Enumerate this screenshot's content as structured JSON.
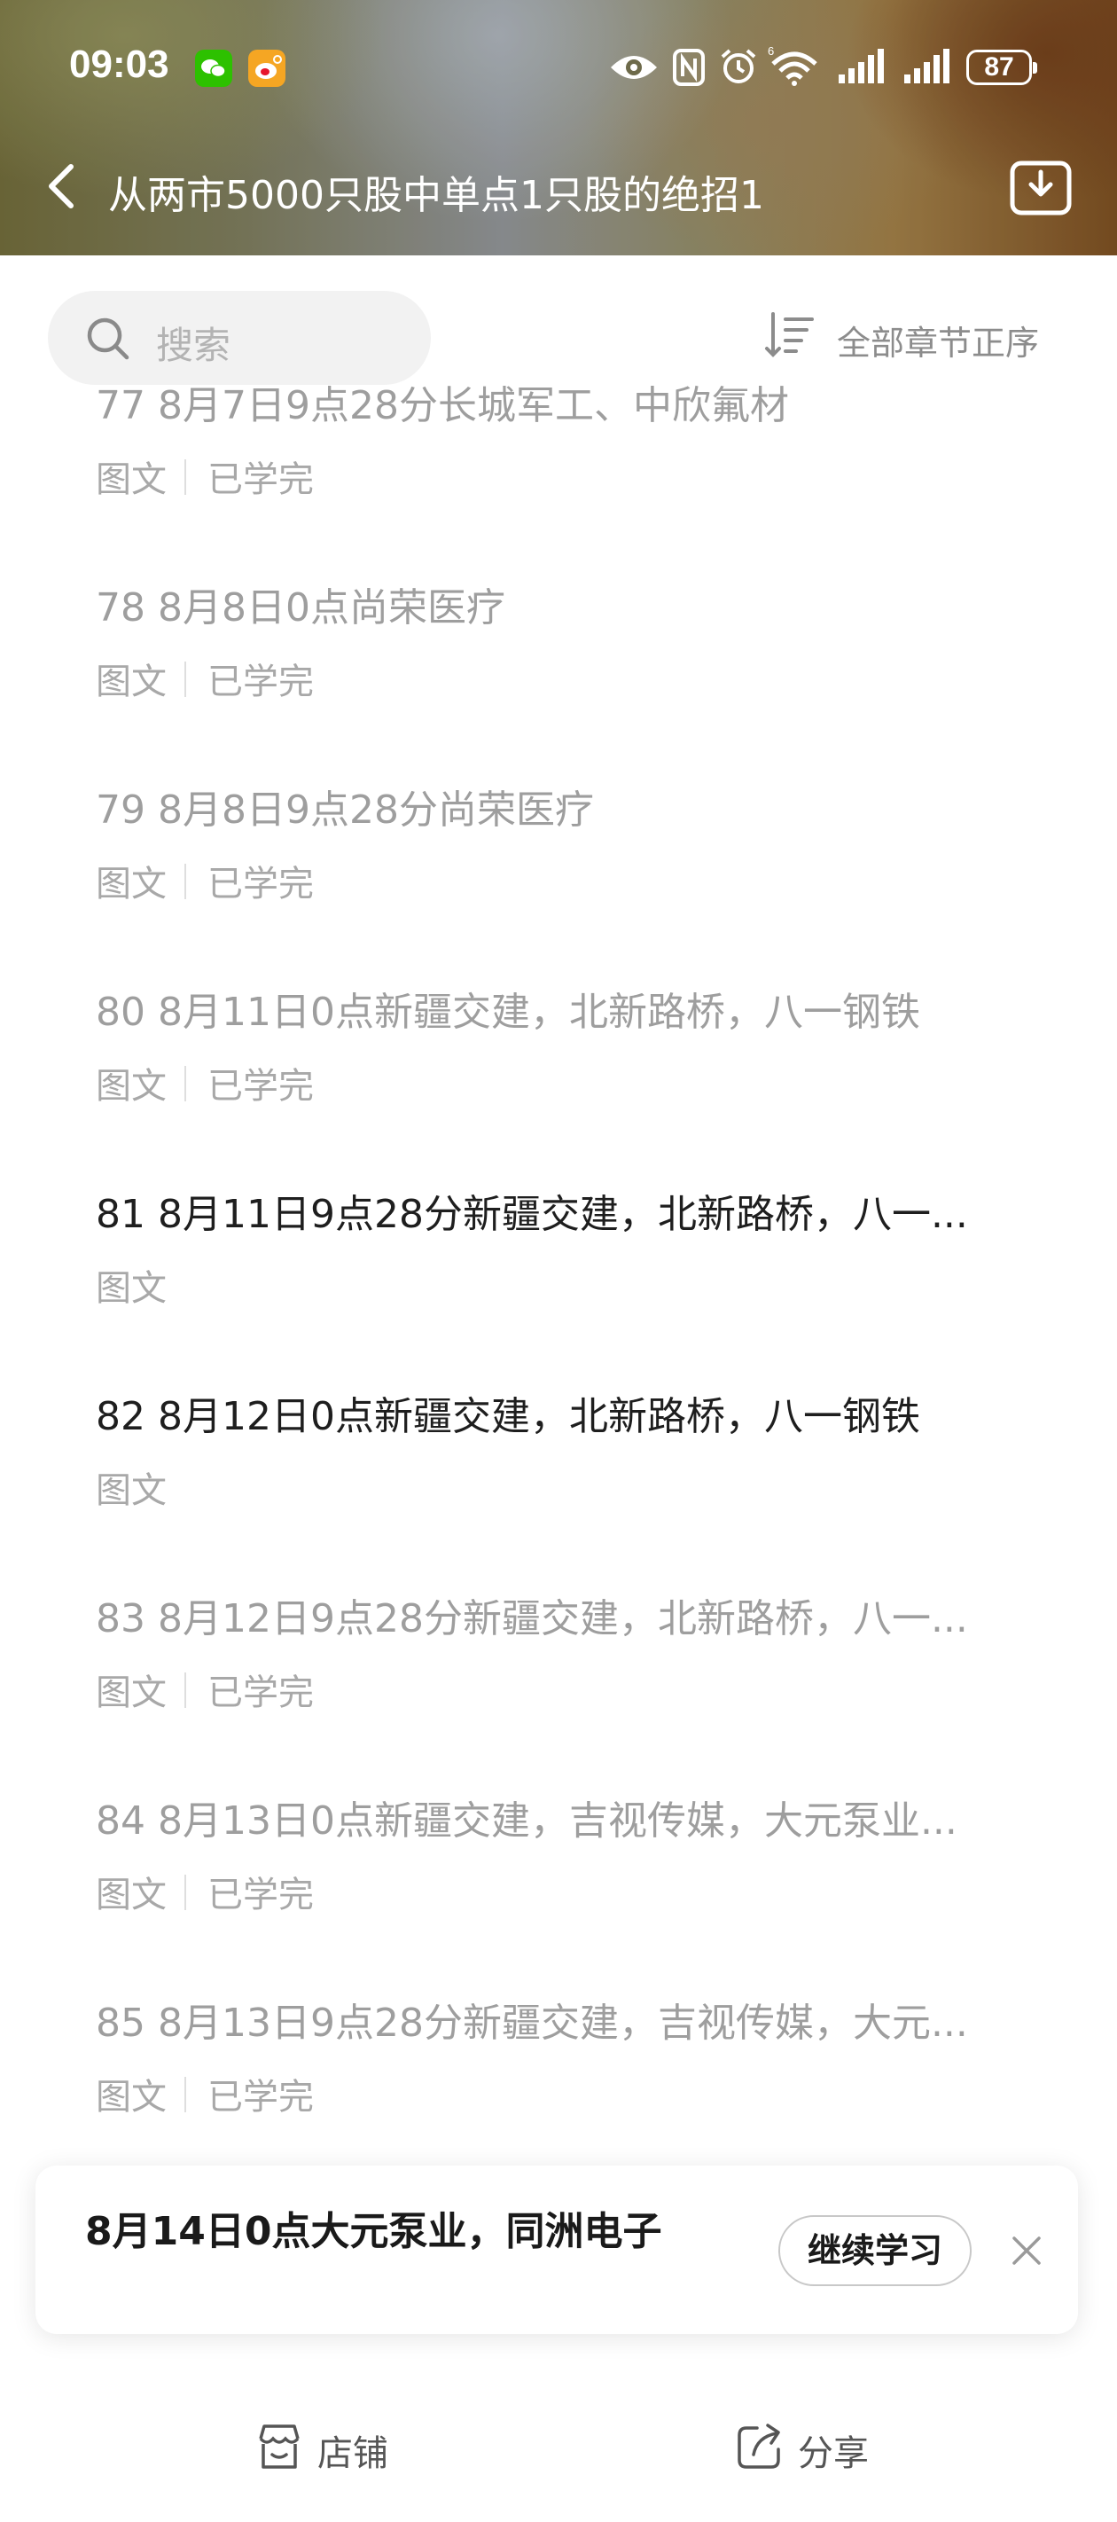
{
  "status_bar": {
    "time": "09:03",
    "battery": "87",
    "icons": [
      "wechat-icon",
      "weibo-icon",
      "eye-icon",
      "nfc-icon",
      "alarm-icon",
      "wifi-6-icon",
      "signal-icon",
      "signal-icon",
      "battery-icon"
    ]
  },
  "header": {
    "title": "从两市5000只股中单点1只股的绝招1",
    "back_icon": "chevron-left-icon",
    "download_icon": "download-icon"
  },
  "search": {
    "placeholder": "搜索"
  },
  "sort": {
    "label": "全部章节正序"
  },
  "chapters": [
    {
      "title": "77 8月7日9点28分长城军工、中欣氟材",
      "type": "图文",
      "status": "已学完",
      "completed": true
    },
    {
      "title": "78 8月8日0点尚荣医疗",
      "type": "图文",
      "status": "已学完",
      "completed": true
    },
    {
      "title": "79 8月8日9点28分尚荣医疗",
      "type": "图文",
      "status": "已学完",
      "completed": true
    },
    {
      "title": "80 8月11日0点新疆交建，北新路桥，八一钢铁",
      "type": "图文",
      "status": "已学完",
      "completed": true
    },
    {
      "title": "81 8月11日9点28分新疆交建，北新路桥，八一...",
      "type": "图文",
      "status": "",
      "completed": false
    },
    {
      "title": "82 8月12日0点新疆交建，北新路桥，八一钢铁",
      "type": "图文",
      "status": "",
      "completed": false
    },
    {
      "title": "83 8月12日9点28分新疆交建，北新路桥，八一...",
      "type": "图文",
      "status": "已学完",
      "completed": true
    },
    {
      "title": "84 8月13日0点新疆交建，吉视传媒，大元泵业...",
      "type": "图文",
      "status": "已学完",
      "completed": true
    },
    {
      "title": "85 8月13日9点28分新疆交建，吉视传媒，大元...",
      "type": "图文",
      "status": "已学完",
      "completed": true
    }
  ],
  "continue_card": {
    "title": "8月14日0点大元泵业，同洲电子",
    "button": "继续学习"
  },
  "bottom_bar": {
    "shop": "店铺",
    "share": "分享"
  },
  "colors": {
    "completed_text": "#9e9e9e",
    "unread_text": "#1e1e1e",
    "wechat_green": "#2dc100",
    "weibo_orange": "#f5a623"
  }
}
